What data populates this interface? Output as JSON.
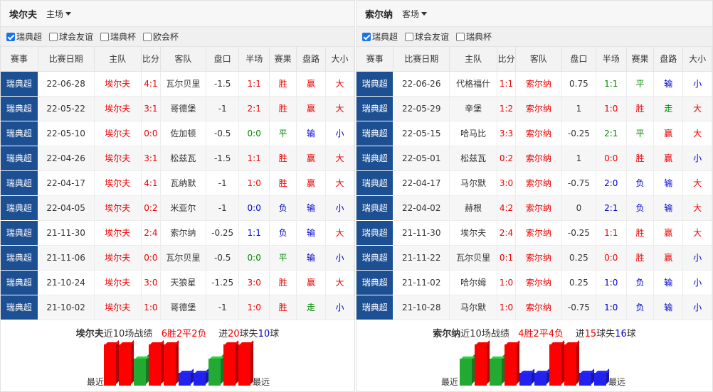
{
  "colors": {
    "win": "#ff0000",
    "draw": "#22aa33",
    "loss": "#2222ee",
    "league_bg": "#1d4f93"
  },
  "columns": [
    "赛事",
    "比赛日期",
    "主队",
    "比分",
    "客队",
    "盘口",
    "半场",
    "赛果",
    "盘路",
    "大小"
  ],
  "left": {
    "team": "埃尔夫",
    "venue": "主场",
    "filters": [
      {
        "label": "瑞典超",
        "checked": true
      },
      {
        "label": "球会友谊",
        "checked": false
      },
      {
        "label": "瑞典杯",
        "checked": false
      },
      {
        "label": "欧会杯",
        "checked": false
      }
    ],
    "rows": [
      {
        "league": "瑞典超",
        "date": "22-06-28",
        "home": "埃尔夫",
        "score": "4:1",
        "away": "瓦尔贝里",
        "line": "-1.5",
        "half": "1:1",
        "result": "胜",
        "ah": "赢",
        "ou": "大"
      },
      {
        "league": "瑞典超",
        "date": "22-05-22",
        "home": "埃尔夫",
        "score": "3:1",
        "away": "哥德堡",
        "line": "-1",
        "half": "2:1",
        "result": "胜",
        "ah": "赢",
        "ou": "大"
      },
      {
        "league": "瑞典超",
        "date": "22-05-10",
        "home": "埃尔夫",
        "score": "0:0",
        "away": "佐加顿",
        "line": "-0.5",
        "half": "0:0",
        "result": "平",
        "ah": "输",
        "ou": "小"
      },
      {
        "league": "瑞典超",
        "date": "22-04-26",
        "home": "埃尔夫",
        "score": "3:1",
        "away": "松兹瓦",
        "line": "-1.5",
        "half": "1:1",
        "result": "胜",
        "ah": "赢",
        "ou": "大"
      },
      {
        "league": "瑞典超",
        "date": "22-04-17",
        "home": "埃尔夫",
        "score": "4:1",
        "away": "瓦纳默",
        "line": "-1",
        "half": "1:0",
        "result": "胜",
        "ah": "赢",
        "ou": "大"
      },
      {
        "league": "瑞典超",
        "date": "22-04-05",
        "home": "埃尔夫",
        "score": "0:2",
        "away": "米亚尔",
        "line": "-1",
        "half": "0:0",
        "result": "负",
        "ah": "输",
        "ou": "小"
      },
      {
        "league": "瑞典超",
        "date": "21-11-30",
        "home": "埃尔夫",
        "score": "2:4",
        "away": "索尔纳",
        "line": "-0.25",
        "half": "1:1",
        "result": "负",
        "ah": "输",
        "ou": "大"
      },
      {
        "league": "瑞典超",
        "date": "21-11-06",
        "home": "埃尔夫",
        "score": "0:0",
        "away": "瓦尔贝里",
        "line": "-0.5",
        "half": "0:0",
        "result": "平",
        "ah": "输",
        "ou": "小"
      },
      {
        "league": "瑞典超",
        "date": "21-10-24",
        "home": "埃尔夫",
        "score": "3:0",
        "away": "天狼星",
        "line": "-1.25",
        "half": "3:0",
        "result": "胜",
        "ah": "赢",
        "ou": "大"
      },
      {
        "league": "瑞典超",
        "date": "21-10-02",
        "home": "埃尔夫",
        "score": "1:0",
        "away": "哥德堡",
        "line": "-1",
        "half": "1:0",
        "result": "胜",
        "ah": "走",
        "ou": "小"
      }
    ],
    "summary": {
      "team": "埃尔夫",
      "label": "近10场战绩",
      "wdl": "6胜2平2负",
      "goals_prefix": "进",
      "scored": "20",
      "mid": "球失",
      "conceded": "10",
      "suffix": "球"
    },
    "trend": [
      "胜",
      "胜",
      "平",
      "胜",
      "胜",
      "负",
      "负",
      "平",
      "胜",
      "胜"
    ],
    "near": "最近",
    "far": "最远"
  },
  "right": {
    "team": "索尔纳",
    "venue": "客场",
    "filters": [
      {
        "label": "瑞典超",
        "checked": true
      },
      {
        "label": "球会友谊",
        "checked": false
      },
      {
        "label": "瑞典杯",
        "checked": false
      }
    ],
    "rows": [
      {
        "league": "瑞典超",
        "date": "22-06-26",
        "home": "代格福什",
        "score": "1:1",
        "away": "索尔纳",
        "line": "0.75",
        "half": "1:1",
        "result": "平",
        "ah": "输",
        "ou": "小"
      },
      {
        "league": "瑞典超",
        "date": "22-05-29",
        "home": "辛堡",
        "score": "1:2",
        "away": "索尔纳",
        "line": "1",
        "half": "1:0",
        "result": "胜",
        "ah": "走",
        "ou": "大"
      },
      {
        "league": "瑞典超",
        "date": "22-05-15",
        "home": "哈马比",
        "score": "3:3",
        "away": "索尔纳",
        "line": "-0.25",
        "half": "2:1",
        "result": "平",
        "ah": "赢",
        "ou": "大"
      },
      {
        "league": "瑞典超",
        "date": "22-05-01",
        "home": "松兹瓦",
        "score": "0:2",
        "away": "索尔纳",
        "line": "1",
        "half": "0:0",
        "result": "胜",
        "ah": "赢",
        "ou": "小"
      },
      {
        "league": "瑞典超",
        "date": "22-04-17",
        "home": "马尔默",
        "score": "3:0",
        "away": "索尔纳",
        "line": "-0.75",
        "half": "2:0",
        "result": "负",
        "ah": "输",
        "ou": "大"
      },
      {
        "league": "瑞典超",
        "date": "22-04-02",
        "home": "赫根",
        "score": "4:2",
        "away": "索尔纳",
        "line": "0",
        "half": "2:1",
        "result": "负",
        "ah": "输",
        "ou": "大"
      },
      {
        "league": "瑞典超",
        "date": "21-11-30",
        "home": "埃尔夫",
        "score": "2:4",
        "away": "索尔纳",
        "line": "-0.25",
        "half": "1:1",
        "result": "胜",
        "ah": "赢",
        "ou": "大"
      },
      {
        "league": "瑞典超",
        "date": "21-11-22",
        "home": "瓦尔贝里",
        "score": "0:1",
        "away": "索尔纳",
        "line": "0.25",
        "half": "0:0",
        "result": "胜",
        "ah": "赢",
        "ou": "小"
      },
      {
        "league": "瑞典超",
        "date": "21-11-02",
        "home": "哈尔姆",
        "score": "1:0",
        "away": "索尔纳",
        "line": "0.25",
        "half": "1:0",
        "result": "负",
        "ah": "输",
        "ou": "小"
      },
      {
        "league": "瑞典超",
        "date": "21-10-28",
        "home": "马尔默",
        "score": "1:0",
        "away": "索尔纳",
        "line": "-0.75",
        "half": "1:0",
        "result": "负",
        "ah": "输",
        "ou": "小"
      }
    ],
    "summary": {
      "team": "索尔纳",
      "label": "近10场战绩",
      "wdl": "4胜2平4负",
      "goals_prefix": "进",
      "scored": "15",
      "mid": "球失",
      "conceded": "16",
      "suffix": "球"
    },
    "trend": [
      "平",
      "胜",
      "平",
      "胜",
      "负",
      "负",
      "胜",
      "胜",
      "负",
      "负"
    ],
    "near": "最近",
    "far": "最远"
  }
}
